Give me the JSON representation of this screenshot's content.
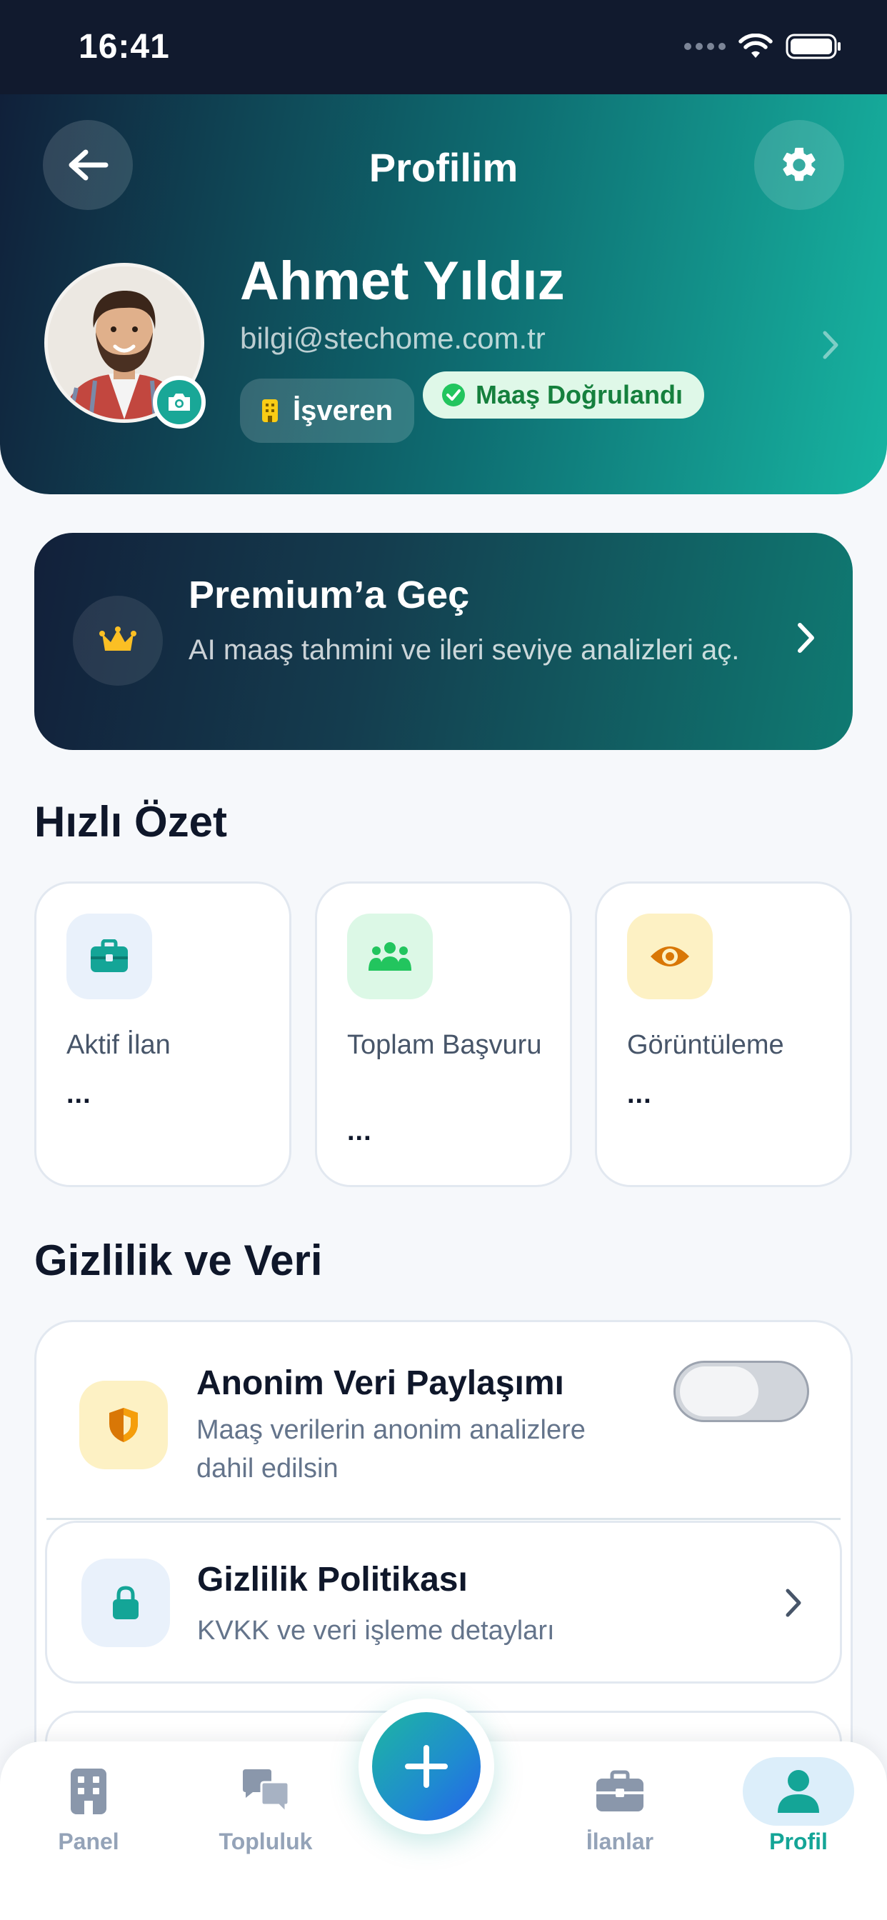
{
  "status_bar": {
    "time": "16:41"
  },
  "header": {
    "title": "Profilim",
    "name": "Ahmet Yıldız",
    "email": "bilgi@stechome.com.tr",
    "role_badge": "İşveren",
    "verified_badge": "Maaş Doğrulandı"
  },
  "premium": {
    "title": "Premium’a Geç",
    "description": "AI maaş tahmini ve ileri seviye analizleri aç."
  },
  "quick_summary": {
    "title": "Hızlı Özet",
    "stats": [
      {
        "label": "Aktif İlan",
        "value": "...",
        "icon": "briefcase-icon",
        "color": "#14a597"
      },
      {
        "label": "Toplam Başvuru",
        "value": "...",
        "icon": "users-icon",
        "color": "#22c55e"
      },
      {
        "label": "Görüntüleme",
        "value": "...",
        "icon": "eye-icon",
        "color": "#d97706"
      }
    ]
  },
  "privacy": {
    "title": "Gizlilik ve Veri",
    "items": [
      {
        "title": "Anonim Veri Paylaşımı",
        "description": "Maaş verilerin anonim analizlere dahil edilsin",
        "toggle_on": false
      },
      {
        "title": "Gizlilik Politikası",
        "description": "KVKK ve veri işleme detayları"
      }
    ]
  },
  "bottom_nav": {
    "items": [
      {
        "label": "Panel",
        "icon": "building-icon"
      },
      {
        "label": "Topluluk",
        "icon": "chat-bubbles-icon"
      },
      {
        "label": "İlanlar",
        "icon": "briefcase-icon"
      },
      {
        "label": "Profil",
        "icon": "person-icon",
        "active": true
      }
    ],
    "fab_icon": "plus-icon"
  },
  "colors": {
    "accent": "#14a597",
    "header_dark": "#10203a",
    "verified": "#15803d"
  }
}
